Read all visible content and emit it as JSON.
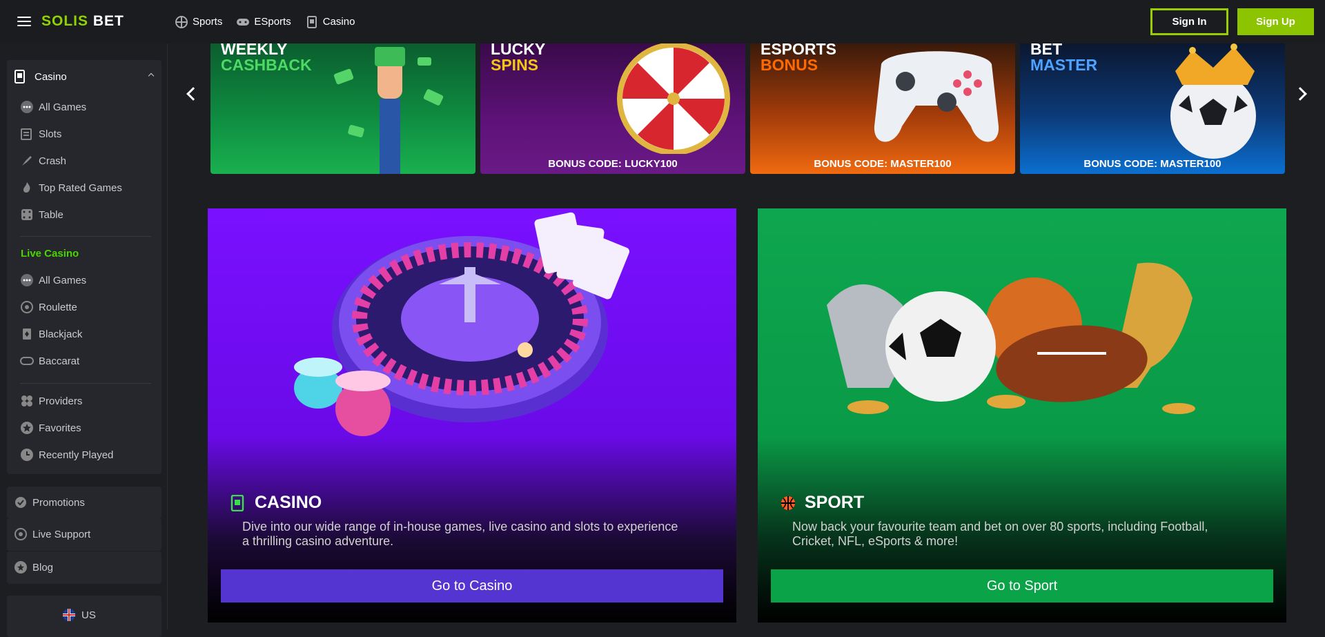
{
  "header": {
    "logo_part1": "SOLIS",
    "logo_part2": "BET",
    "nav": [
      "Sports",
      "ESports",
      "Casino"
    ],
    "signin_label": "Sign In",
    "signup_label": "Sign Up"
  },
  "sidebar": {
    "casino_title": "Casino",
    "casino_items": [
      "All Games",
      "Slots",
      "Crash",
      "Top Rated Games",
      "Table"
    ],
    "live_title": "Live Casino",
    "live_items": [
      "All Games",
      "Roulette",
      "Blackjack",
      "Baccarat"
    ],
    "extra_items": [
      "Providers",
      "Favorites",
      "Recently Played"
    ],
    "promotions": "Promotions",
    "live_support": "Live Support",
    "blog": "Blog",
    "language": "US"
  },
  "promos": [
    {
      "line1": "WEEKLY",
      "line2": "CASHBACK",
      "code": "",
      "line2_color": "#4cd964"
    },
    {
      "line1": "LUCKY",
      "line2": "SPINS",
      "code": "BONUS CODE: LUCKY100",
      "line2_color": "#f5c518"
    },
    {
      "line1": "ESPORTS",
      "line2": "BONUS",
      "code": "BONUS CODE: MASTER100",
      "line2_color": "#ff6a00"
    },
    {
      "line1": "BET",
      "line2": "MASTER",
      "code": "BONUS CODE: MASTER100",
      "line2_color": "#4da3ff"
    }
  ],
  "cards": {
    "casino": {
      "title": "CASINO",
      "description": "Dive into our wide range of in-house games, live casino and slots to experience a thrilling casino adventure.",
      "button": "Go to Casino"
    },
    "sport": {
      "title": "SPORT",
      "description": "Now back your favourite team and bet on over 80 sports, including Football, Cricket, NFL, eSports & more!",
      "button": "Go to Sport"
    }
  },
  "colors": {
    "accent": "#8cc400",
    "live_casino": "#4ad400",
    "casino_button": "#5535d1",
    "sport_button": "#0aa348"
  }
}
